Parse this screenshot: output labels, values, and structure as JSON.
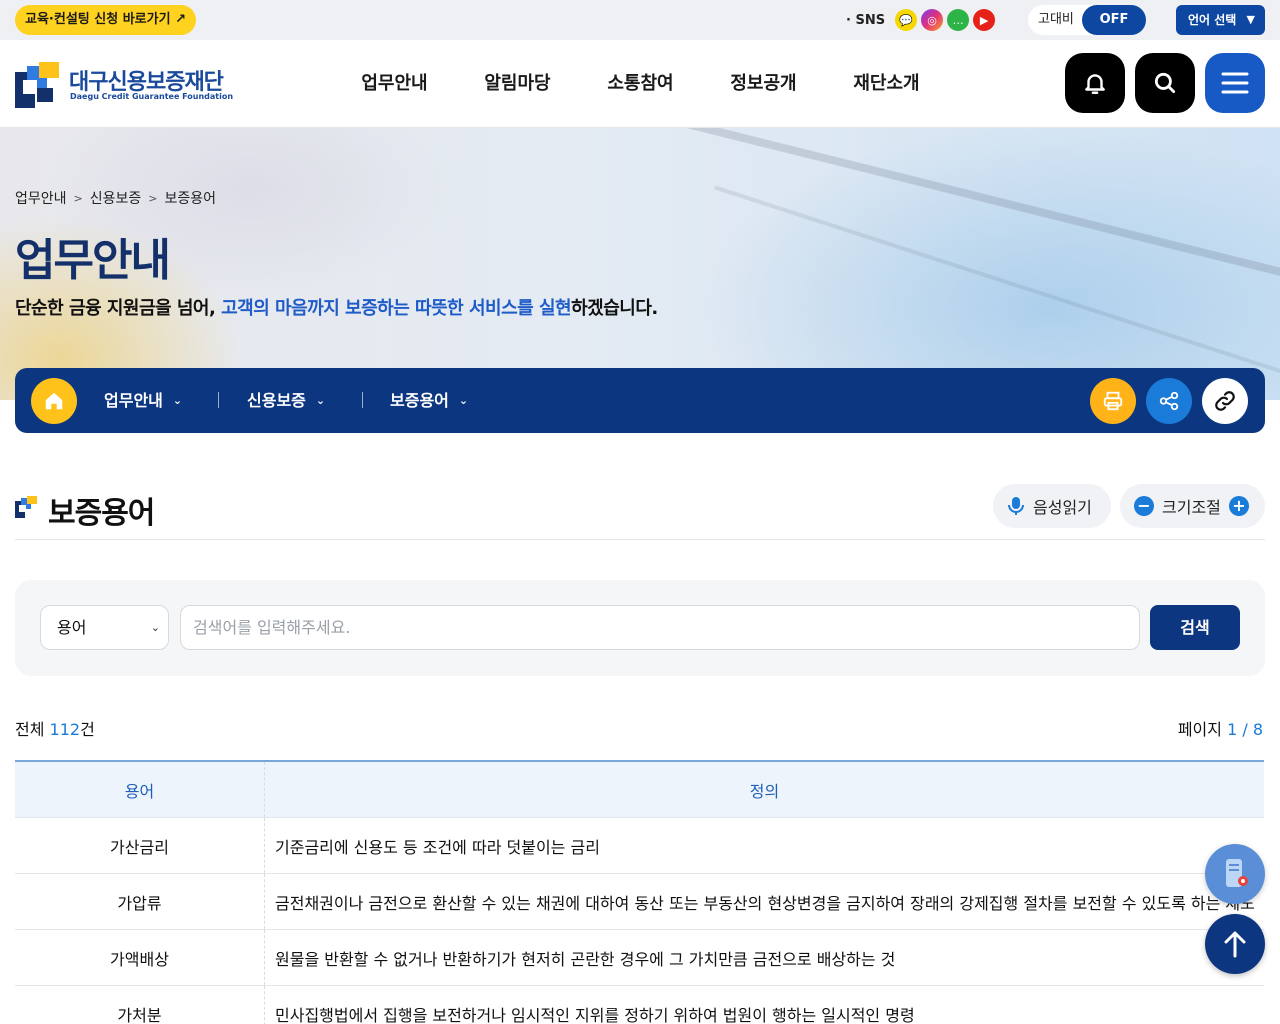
{
  "topbar": {
    "edu_link": "교육·컨설팅 신청 바로가기 ↗",
    "sns_label": "· SNS",
    "sns": [
      {
        "name": "kakao-icon",
        "glyph": "💬"
      },
      {
        "name": "instagram-icon",
        "glyph": "◎"
      },
      {
        "name": "talk-icon",
        "glyph": "…"
      },
      {
        "name": "youtube-icon",
        "glyph": "▶"
      }
    ],
    "contrast_label": "고대비",
    "contrast_state": "OFF",
    "language_label": "언어 선택",
    "language_caret": "▼"
  },
  "header": {
    "logo_kr": "대구신용보증재단",
    "logo_en": "Daegu Credit Guarantee Foundation",
    "nav": [
      "업무안내",
      "알림마당",
      "소통참여",
      "정보공개",
      "재단소개"
    ]
  },
  "visual": {
    "breadcrumb": [
      "업무안내",
      "신용보증",
      "보증용어"
    ],
    "breadcrumb_sep": ">",
    "title": "업무안내",
    "slogan_pre": "단순한 금융 지원금을 넘어, ",
    "slogan_highlight": "고객의 마음까지 보증하는 따뜻한 서비스를 실현",
    "slogan_post": "하겠습니다."
  },
  "location": {
    "items": [
      "업무안내",
      "신용보증",
      "보증용어"
    ],
    "chevron": "⌄"
  },
  "content": {
    "title": "보증용어",
    "voice_label": "음성읽기",
    "size_label": "크기조절",
    "size_minus": "−",
    "size_plus": "+"
  },
  "search": {
    "select_value": "용어",
    "select_chevron": "⌄",
    "placeholder": "검색어를 입력해주세요.",
    "button": "검색"
  },
  "counts": {
    "total_prefix": "전체",
    "total_num": "112",
    "total_suffix": "건",
    "page_prefix": "페이지",
    "page_value": "1 / 8"
  },
  "table": {
    "headers": {
      "term": "용어",
      "definition": "정의"
    },
    "rows": [
      {
        "term": "가산금리",
        "definition": "기준금리에 신용도 등 조건에 따라 덧붙이는 금리"
      },
      {
        "term": "가압류",
        "definition": "금전채권이나 금전으로 환산할 수 있는 채권에 대하여 동산 또는 부동산의 현상변경을 금지하여 장래의 강제집행 절차를 보전할 수 있도록 하는 제도"
      },
      {
        "term": "가액배상",
        "definition": "원물을 반환할 수 없거나 반환하기가 현저히 곤란한 경우에 그 가치만큼 금전으로 배상하는 것"
      },
      {
        "term": "가처분",
        "definition": "민사집행법에서 집행을 보전하거나 임시적인 지위를 정하기 위하여 법원이 행하는 일시적인 명령"
      }
    ]
  },
  "colors": {
    "brand_navy": "#0d3680",
    "accent_blue": "#1b7bd8",
    "accent_yellow": "#ffc21a"
  }
}
